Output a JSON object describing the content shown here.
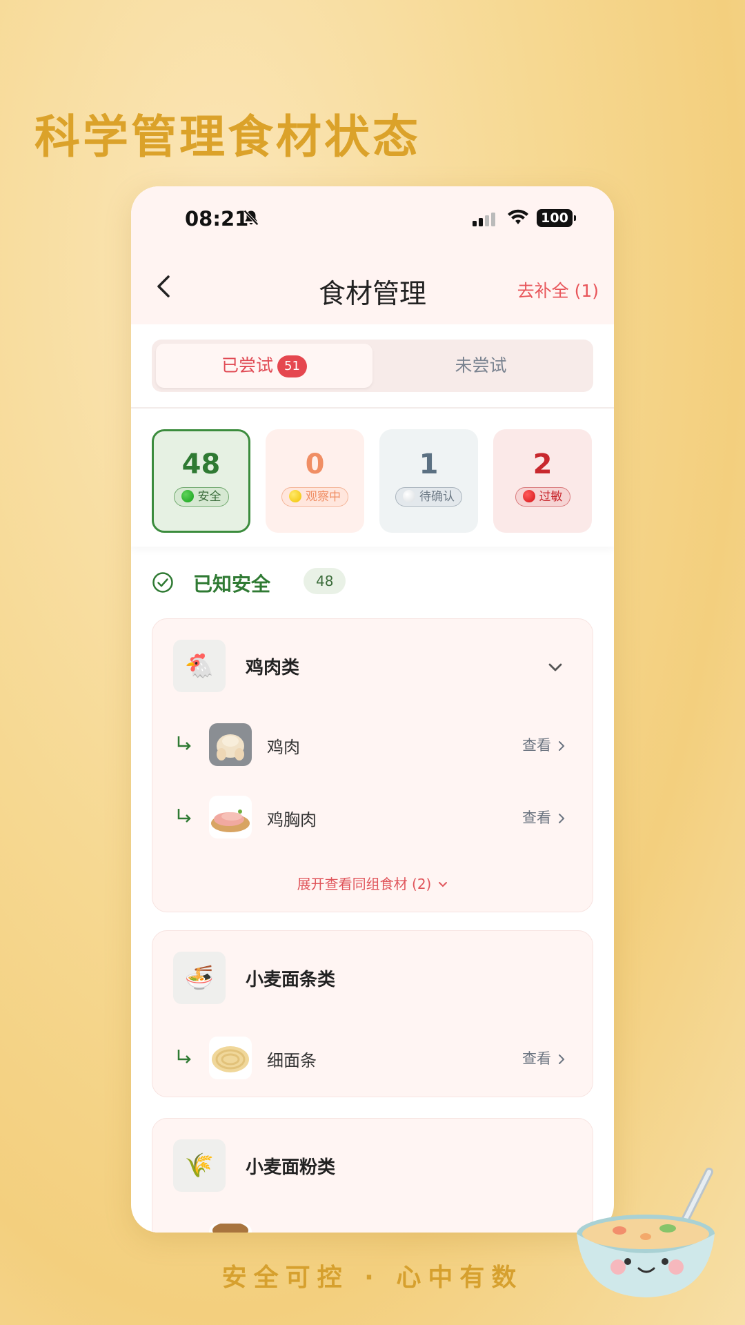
{
  "poster": {
    "title": "科学管理食材状态",
    "slogan": "安全可控 · 心中有数"
  },
  "status_bar": {
    "time": "08:21",
    "battery": "100"
  },
  "nav": {
    "title": "食材管理",
    "action": "去补全 (1)"
  },
  "tabs": {
    "tried_label": "已尝试",
    "tried_badge": "51",
    "untried_label": "未尝试"
  },
  "stats": {
    "safe": {
      "value": "48",
      "label": "安全",
      "color": "#2f7a33"
    },
    "observing": {
      "value": "0",
      "label": "观察中",
      "color": "#f08e64"
    },
    "pending": {
      "value": "1",
      "label": "待确认",
      "color": "#5b7082"
    },
    "allergic": {
      "value": "2",
      "label": "过敏",
      "color": "#c8282e"
    }
  },
  "section": {
    "title": "已知安全",
    "count": "48"
  },
  "groups": [
    {
      "name": "鸡肉类",
      "icon": "chicken-icon",
      "items": [
        {
          "name": "鸡肉",
          "action": "查看"
        },
        {
          "name": "鸡胸肉",
          "action": "查看"
        }
      ],
      "expand_label": "展开查看同组食材 (2)"
    },
    {
      "name": "小麦面条类",
      "icon": "noodle-bowl-icon",
      "items": [
        {
          "name": "细面条",
          "action": "查看"
        }
      ]
    },
    {
      "name": "小麦面粉类",
      "icon": "wheat-icon",
      "items": []
    }
  ]
}
